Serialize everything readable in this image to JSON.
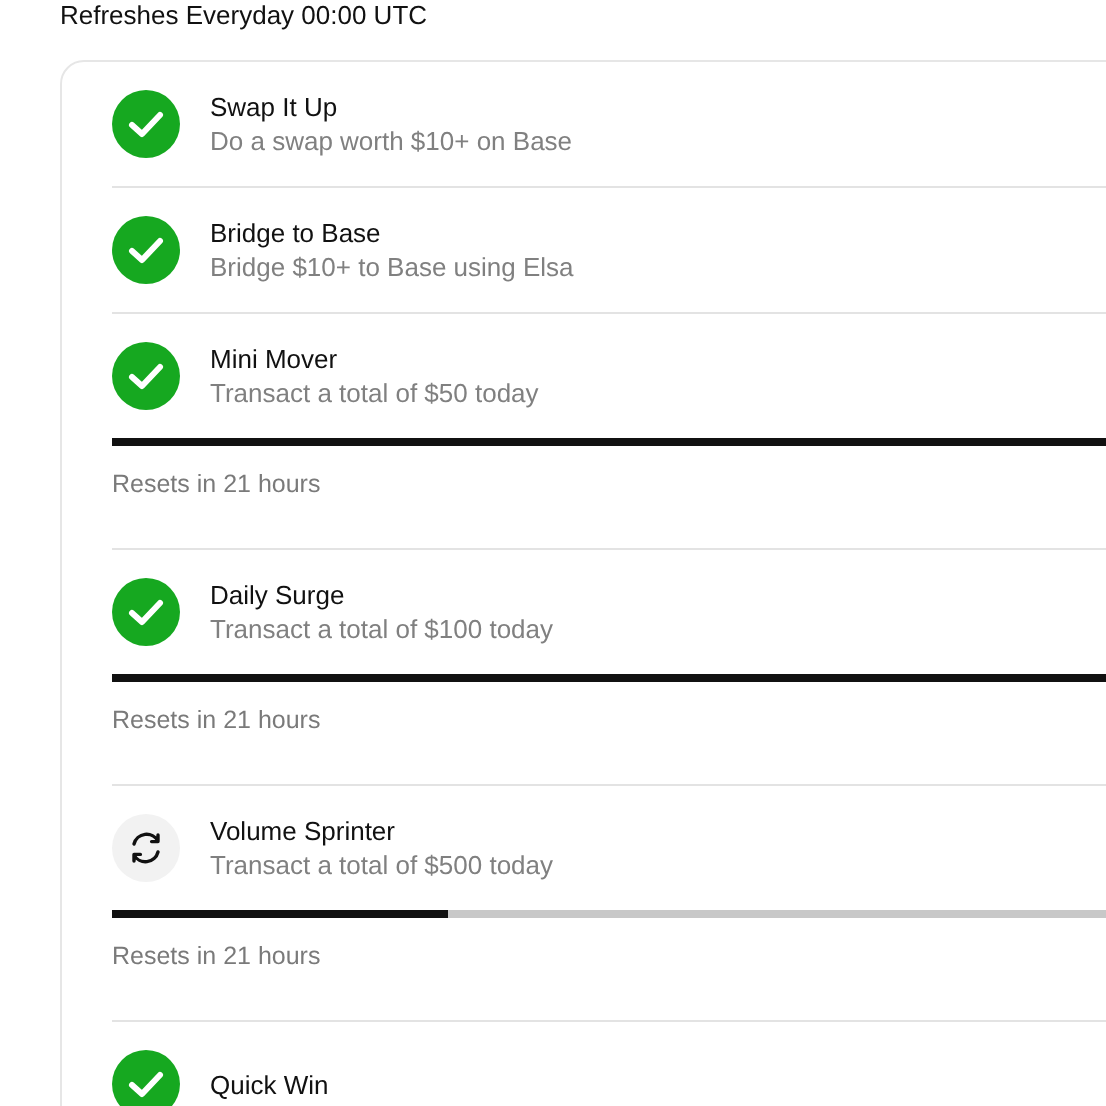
{
  "header": {
    "text": "Refreshes Everyday 00:00 UTC"
  },
  "quests": [
    {
      "kind": "simple",
      "title": "Swap It Up",
      "description": "Do a swap worth $10+ on Base",
      "completed": true
    },
    {
      "kind": "simple",
      "title": "Bridge to Base",
      "description": "Bridge $10+ to Base using Elsa",
      "completed": true
    },
    {
      "kind": "progress",
      "title": "Mini Mover",
      "description": "Transact a total of $50 today",
      "completed": true,
      "level": 1,
      "reset": "Resets in 21 hours"
    },
    {
      "kind": "progress",
      "title": "Daily Surge",
      "description": "Transact a total of $100 today",
      "completed": true,
      "level": 1,
      "reset": "Resets in 21 hours"
    },
    {
      "kind": "progress",
      "title": "Volume Sprinter",
      "description": "Transact a total of $500 today",
      "completed": false,
      "level": 0.32,
      "reset": "Resets in 21 hours"
    },
    {
      "kind": "simple",
      "title": "Quick Win",
      "completed": true
    }
  ]
}
